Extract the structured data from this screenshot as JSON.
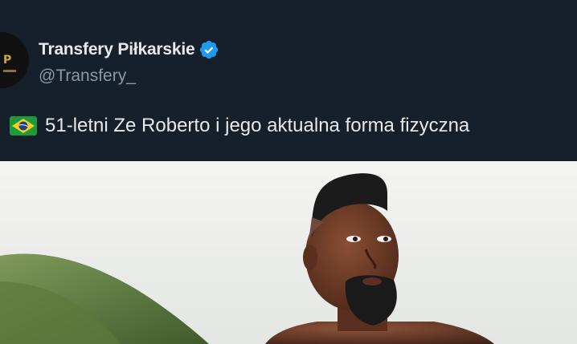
{
  "account": {
    "display_name": "Transfery Piłkarskie",
    "handle": "@Transfery_",
    "verified": true,
    "avatar_icon": "transfery-logo"
  },
  "tweet": {
    "flag_icon": "brazil-flag",
    "text": "51-letni Ze Roberto i jego aktualna forma fizyczna"
  },
  "media": {
    "type": "photo",
    "icon": "photo-man-outdoors"
  },
  "colors": {
    "background": "#15202b",
    "text": "#e7e9ea",
    "secondary_text": "#8b98a5",
    "verified_blue": "#1d9bf0"
  }
}
